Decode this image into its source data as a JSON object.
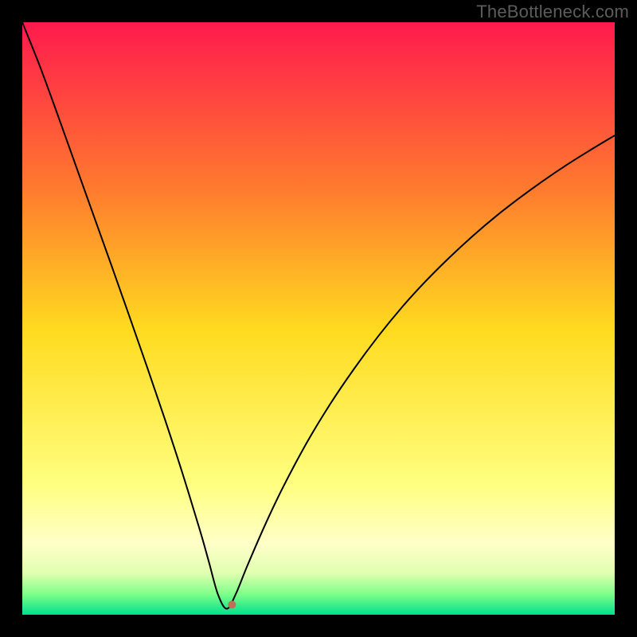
{
  "watermark": "TheBottleneck.com",
  "colors": {
    "black": "#000000",
    "marker": "#c76b5a"
  },
  "chart_data": {
    "type": "line",
    "title": "",
    "xlabel": "",
    "ylabel": "",
    "xlim": [
      0,
      100
    ],
    "ylim": [
      0,
      100
    ],
    "grid": false,
    "legend": false,
    "background_gradient_stops": [
      {
        "pos": 0.0,
        "color": "#ff1a4d"
      },
      {
        "pos": 0.28,
        "color": "#ff7a2e"
      },
      {
        "pos": 0.52,
        "color": "#ffdb1f"
      },
      {
        "pos": 0.78,
        "color": "#ffff80"
      },
      {
        "pos": 0.88,
        "color": "#ffffc8"
      },
      {
        "pos": 0.93,
        "color": "#e0ffb0"
      },
      {
        "pos": 0.965,
        "color": "#7fff8a"
      },
      {
        "pos": 1.0,
        "color": "#00e08c"
      }
    ],
    "vertex": {
      "x": 34.5,
      "y": 1.0
    },
    "marker": {
      "x": 35.4,
      "y": 1.7,
      "r": 5
    },
    "series": [
      {
        "name": "curve",
        "color": "#000000",
        "width": 2,
        "x": [
          0,
          3,
          6,
          9,
          12,
          15,
          18,
          21,
          24,
          27,
          30,
          31.5,
          33,
          34.5,
          36,
          38,
          41,
          44,
          48,
          52,
          56,
          60,
          64,
          68,
          72,
          76,
          80,
          84,
          88,
          92,
          96,
          100
        ],
        "y": [
          100,
          92.5,
          84.3,
          75.9,
          67.5,
          59.1,
          50.6,
          42.0,
          33.2,
          24.0,
          14.2,
          8.9,
          3.5,
          1.0,
          3.4,
          8.3,
          15.2,
          21.5,
          29.0,
          35.6,
          41.5,
          46.9,
          51.8,
          56.2,
          60.2,
          63.9,
          67.3,
          70.4,
          73.3,
          76.0,
          78.5,
          80.9
        ]
      }
    ]
  }
}
